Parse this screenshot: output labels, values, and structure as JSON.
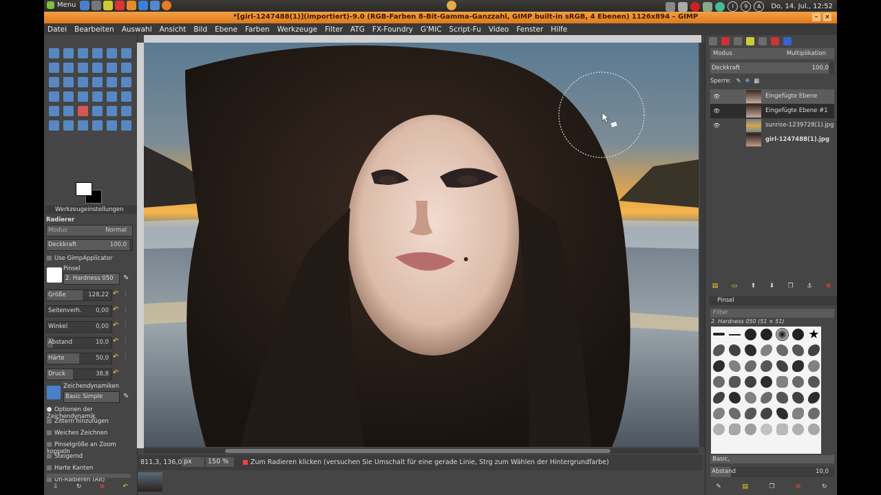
{
  "system": {
    "menu_label": "Menu",
    "status_letters": [
      "I",
      "9",
      "A"
    ],
    "clock": "Do, 14. Jul., 12:52"
  },
  "window": {
    "title": "*[girl-1247488(1)](importiert)-9.0 (RGB-Farben 8-Bit-Gamma-Ganzzahl, GIMP built-in sRGB, 4 Ebenen) 1126x894 – GIMP"
  },
  "menubar": [
    "Datei",
    "Bearbeiten",
    "Auswahl",
    "Ansicht",
    "Bild",
    "Ebene",
    "Farben",
    "Werkzeuge",
    "Filter",
    "ATG",
    "FX-Foundry",
    "G'MIC",
    "Script-Fu",
    "Video",
    "Fenster",
    "Hilfe"
  ],
  "tool_options": {
    "tab_label": "Werkzeugeinstellungen",
    "tool_name": "Radierer",
    "mode_label": "Modus",
    "mode_value": "Normal",
    "opacity_label": "Deckkraft",
    "opacity_value": "100,0",
    "use_gimpapplicator": "Use GimpApplicator",
    "brush_label": "Pinsel",
    "brush_value": "2. Hardness 050",
    "params": [
      {
        "label": "Größe",
        "value": "128,22",
        "fill": 0.55
      },
      {
        "label": "Seitenverh.",
        "value": "0,00",
        "fill": 0
      },
      {
        "label": "Winkel",
        "value": "0,00",
        "fill": 0
      },
      {
        "label": "Abstand",
        "value": "10,0",
        "fill": 0.1
      },
      {
        "label": "Härte",
        "value": "50,0",
        "fill": 0.5
      },
      {
        "label": "Druck",
        "value": "38,8",
        "fill": 0.4
      }
    ],
    "dynamics_label": "Zeichendynamiken",
    "dynamics_value": "Basic Simple",
    "checks": [
      "Optionen der Zeichendynamik",
      "Zittern hinzufügen",
      "Weiches Zeichnen",
      "Pinselgröße an Zoom koppeln",
      "Steigernd",
      "Harte Kanten",
      "Un-Radieren (Alt)"
    ]
  },
  "status": {
    "coords": "811,3, 136,0",
    "unit": "px",
    "zoom": "150 %",
    "message": "Zum Radieren klicken (versuchen Sie Umschalt für eine gerade Linie, Strg zum Wählen der Hintergrundfarbe)"
  },
  "layers_panel": {
    "mode_label": "Modus",
    "mode_value": "Multiplikation",
    "opacity_label": "Deckkraft",
    "opacity_value": "100,0",
    "lock_label": "Sperre:",
    "layers": [
      {
        "name": "Eingefügte Ebene",
        "visible": true,
        "selected": false
      },
      {
        "name": "Eingefügte Ebene #1",
        "visible": true,
        "selected": true
      },
      {
        "name": "sunrise-1239728(1).jpg",
        "visible": true,
        "selected": false
      },
      {
        "name": "girl-1247488(1).jpg",
        "visible": false,
        "selected": false
      }
    ]
  },
  "brushes_panel": {
    "tab_label": "Pinsel",
    "filter_placeholder": "Filter",
    "brush_info": "2. Hardness 050 (51 × 51)",
    "tag_value": "Basic,",
    "spacing_label": "Abstand",
    "spacing_value": "10,0"
  },
  "colors": {
    "accent": "#e8801e",
    "fg": "#ffffff",
    "bg": "#000000"
  }
}
